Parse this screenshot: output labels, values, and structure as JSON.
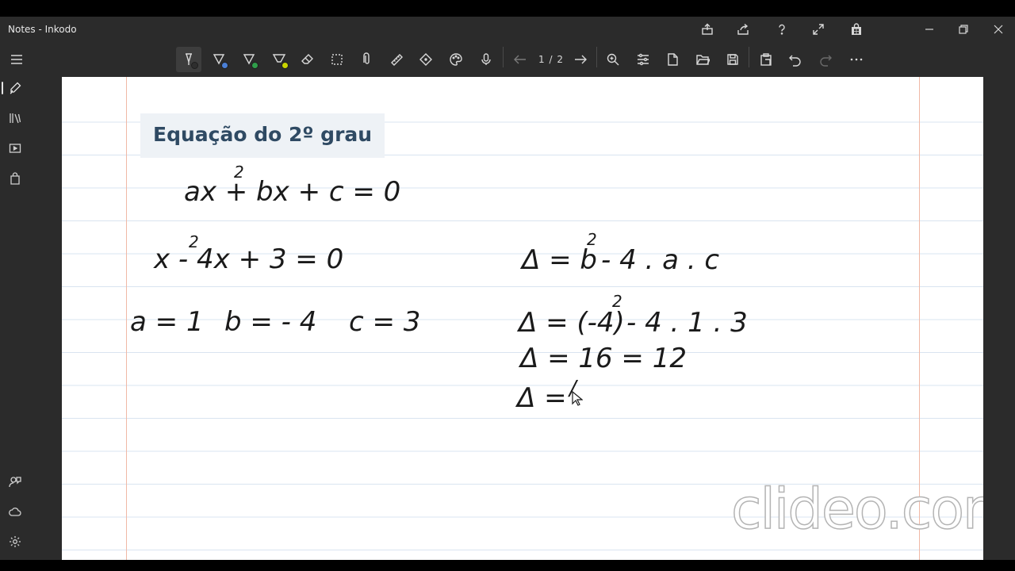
{
  "window": {
    "title": "Notes - Inkodo"
  },
  "toolbar": {
    "page_indicator": "1 / 2"
  },
  "pens": [
    {
      "name": "pen-black",
      "color": "#2e2e2e"
    },
    {
      "name": "pen-blue",
      "color": "#4a7fd6"
    },
    {
      "name": "pen-green",
      "color": "#2f9e4a"
    },
    {
      "name": "highlighter-yellow",
      "color": "#c9d400"
    }
  ],
  "note": {
    "heading": "Equação do 2º grau",
    "general_form": {
      "text": "ax + bx + c = 0",
      "exp": "2"
    },
    "equation": {
      "text": "x - 4x + 3 = 0",
      "exp": "2"
    },
    "coef_a": "a = 1",
    "coef_b": "b = - 4",
    "coef_c": "c = 3",
    "delta_formula": {
      "left": "Δ = b",
      "exp": "2",
      "right": "- 4 . a . c"
    },
    "delta_sub": {
      "left": "Δ = (-4)",
      "exp": "2",
      "right": "- 4 . 1 . 3"
    },
    "delta_step": "Δ = 16 = 12",
    "delta_result": "Δ =",
    "delta_partial": "/"
  },
  "watermark": "clideo.com"
}
